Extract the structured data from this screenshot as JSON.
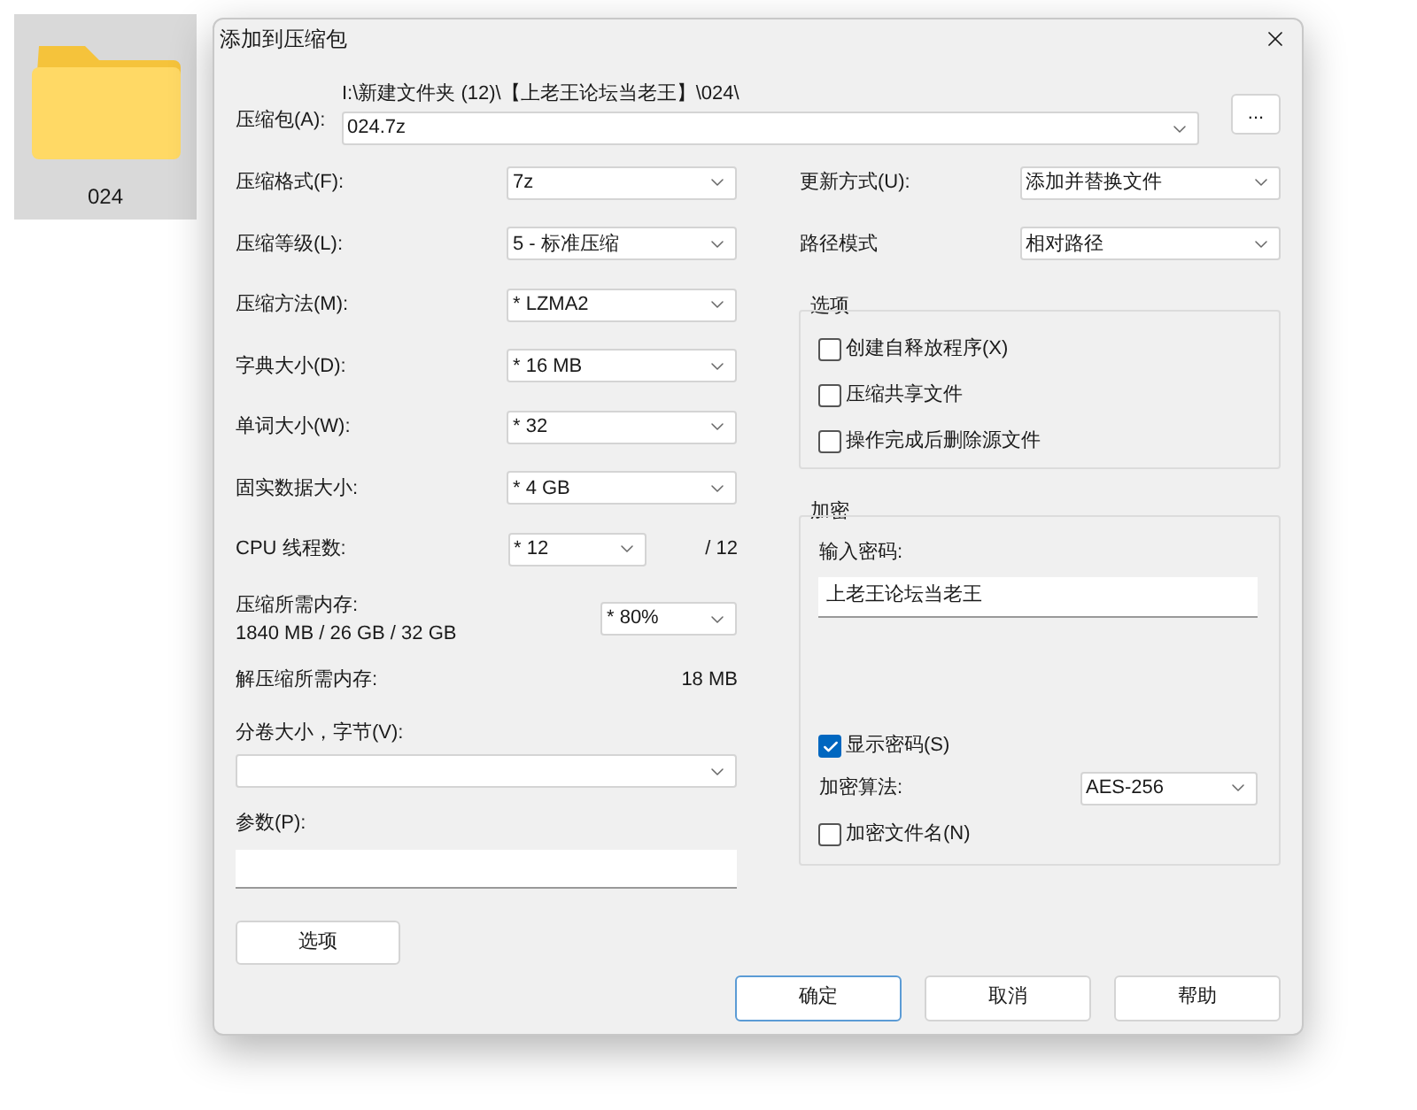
{
  "desktop_item": {
    "label": "024",
    "selected": true
  },
  "dialog": {
    "title": "添加到压缩包"
  },
  "archive": {
    "label": "压缩包(A):",
    "path": "I:\\新建文件夹 (12)\\【上老王论坛当老王】\\024\\",
    "value": "024.7z",
    "browse": "..."
  },
  "left_fields": [
    {
      "kind": "combo",
      "label": "压缩格式(F):",
      "value": "7z"
    },
    {
      "kind": "combo",
      "label": "压缩等级(L):",
      "value": "5 - 标准压缩"
    },
    {
      "kind": "combo",
      "label": "压缩方法(M):",
      "value": "* LZMA2"
    },
    {
      "kind": "combo",
      "label": "字典大小(D):",
      "value": "* 16 MB"
    },
    {
      "kind": "combo",
      "label": "单词大小(W):",
      "value": "* 32"
    },
    {
      "kind": "combo",
      "label": "固实数据大小:",
      "value": "* 4 GB"
    },
    {
      "kind": "cpu",
      "label": "CPU 线程数:",
      "value": "* 12",
      "total": "/ 12"
    },
    {
      "kind": "memory",
      "label": "压缩所需内存:",
      "detail": "1840 MB / 26 GB / 32 GB",
      "value": "* 80%"
    },
    {
      "kind": "info",
      "label": "解压缩所需内存:",
      "value": "18 MB"
    },
    {
      "kind": "wide_combo",
      "label": "分卷大小，字节(V):"
    },
    {
      "kind": "input",
      "label": "参数(P):"
    }
  ],
  "options_button": "选项",
  "right_fields": [
    {
      "label": "更新方式(U):",
      "value": "添加并替换文件"
    },
    {
      "label": "路径模式",
      "value": "相对路径"
    }
  ],
  "options": {
    "title": "选项",
    "items": [
      {
        "label": "创建自释放程序(X)",
        "checked": false
      },
      {
        "label": "压缩共享文件",
        "checked": false
      },
      {
        "label": "操作完成后删除源文件",
        "checked": false
      }
    ]
  },
  "encryption": {
    "title": "加密",
    "password_label": "输入密码:",
    "password": "上老王论坛当老王",
    "show_password": {
      "label": "显示密码(S)",
      "checked": true
    },
    "method_label": "加密算法:",
    "method": "AES-256",
    "encrypt_names": {
      "label": "加密文件名(N)",
      "checked": false
    }
  },
  "buttons": [
    {
      "label": "确定",
      "default": true
    },
    {
      "label": "取消",
      "default": false
    },
    {
      "label": "帮助",
      "default": false
    }
  ]
}
